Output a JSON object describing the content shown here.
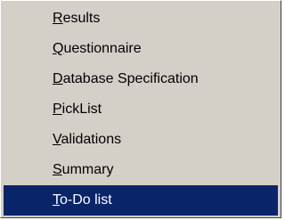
{
  "menu": {
    "items": [
      {
        "mnemonic": "R",
        "rest": "esults",
        "selected": false
      },
      {
        "mnemonic": "Q",
        "rest": "uestionnaire",
        "selected": false
      },
      {
        "mnemonic": "D",
        "rest": "atabase Specification",
        "selected": false
      },
      {
        "mnemonic": "P",
        "rest": "ickList",
        "selected": false
      },
      {
        "mnemonic": "V",
        "rest": "alidations",
        "selected": false
      },
      {
        "mnemonic": "S",
        "rest": "ummary",
        "selected": false
      },
      {
        "mnemonic": "T",
        "rest": "o-Do list",
        "selected": true
      }
    ],
    "colors": {
      "face": "#d4d0c8",
      "highlight": "#0a246a",
      "highlight_text": "#ffffff",
      "text": "#000000"
    }
  }
}
